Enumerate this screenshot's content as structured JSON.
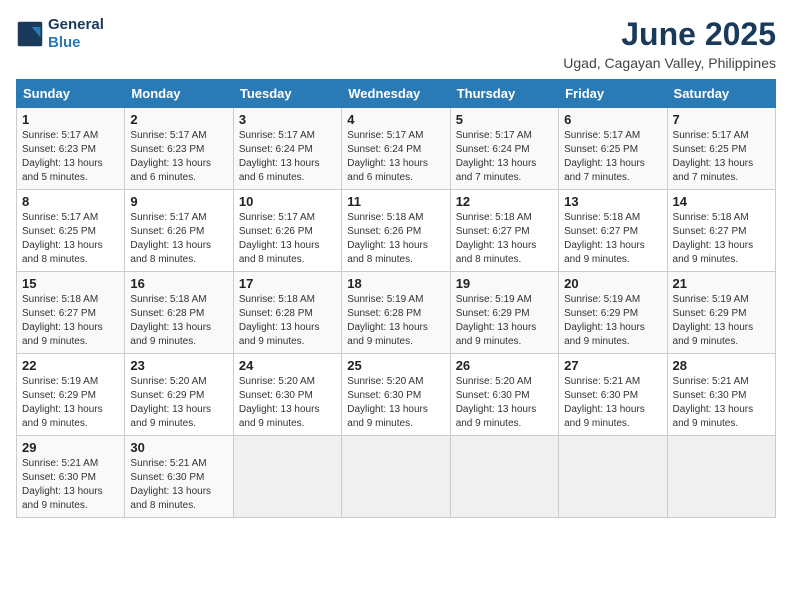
{
  "header": {
    "logo_line1": "General",
    "logo_line2": "Blue",
    "title": "June 2025",
    "subtitle": "Ugad, Cagayan Valley, Philippines"
  },
  "columns": [
    "Sunday",
    "Monday",
    "Tuesday",
    "Wednesday",
    "Thursday",
    "Friday",
    "Saturday"
  ],
  "weeks": [
    [
      {
        "day": "1",
        "sunrise": "5:17 AM",
        "sunset": "6:23 PM",
        "daylight": "13 hours and 5 minutes."
      },
      {
        "day": "2",
        "sunrise": "5:17 AM",
        "sunset": "6:23 PM",
        "daylight": "13 hours and 6 minutes."
      },
      {
        "day": "3",
        "sunrise": "5:17 AM",
        "sunset": "6:24 PM",
        "daylight": "13 hours and 6 minutes."
      },
      {
        "day": "4",
        "sunrise": "5:17 AM",
        "sunset": "6:24 PM",
        "daylight": "13 hours and 6 minutes."
      },
      {
        "day": "5",
        "sunrise": "5:17 AM",
        "sunset": "6:24 PM",
        "daylight": "13 hours and 7 minutes."
      },
      {
        "day": "6",
        "sunrise": "5:17 AM",
        "sunset": "6:25 PM",
        "daylight": "13 hours and 7 minutes."
      },
      {
        "day": "7",
        "sunrise": "5:17 AM",
        "sunset": "6:25 PM",
        "daylight": "13 hours and 7 minutes."
      }
    ],
    [
      {
        "day": "8",
        "sunrise": "5:17 AM",
        "sunset": "6:25 PM",
        "daylight": "13 hours and 8 minutes."
      },
      {
        "day": "9",
        "sunrise": "5:17 AM",
        "sunset": "6:26 PM",
        "daylight": "13 hours and 8 minutes."
      },
      {
        "day": "10",
        "sunrise": "5:17 AM",
        "sunset": "6:26 PM",
        "daylight": "13 hours and 8 minutes."
      },
      {
        "day": "11",
        "sunrise": "5:18 AM",
        "sunset": "6:26 PM",
        "daylight": "13 hours and 8 minutes."
      },
      {
        "day": "12",
        "sunrise": "5:18 AM",
        "sunset": "6:27 PM",
        "daylight": "13 hours and 8 minutes."
      },
      {
        "day": "13",
        "sunrise": "5:18 AM",
        "sunset": "6:27 PM",
        "daylight": "13 hours and 9 minutes."
      },
      {
        "day": "14",
        "sunrise": "5:18 AM",
        "sunset": "6:27 PM",
        "daylight": "13 hours and 9 minutes."
      }
    ],
    [
      {
        "day": "15",
        "sunrise": "5:18 AM",
        "sunset": "6:27 PM",
        "daylight": "13 hours and 9 minutes."
      },
      {
        "day": "16",
        "sunrise": "5:18 AM",
        "sunset": "6:28 PM",
        "daylight": "13 hours and 9 minutes."
      },
      {
        "day": "17",
        "sunrise": "5:18 AM",
        "sunset": "6:28 PM",
        "daylight": "13 hours and 9 minutes."
      },
      {
        "day": "18",
        "sunrise": "5:19 AM",
        "sunset": "6:28 PM",
        "daylight": "13 hours and 9 minutes."
      },
      {
        "day": "19",
        "sunrise": "5:19 AM",
        "sunset": "6:29 PM",
        "daylight": "13 hours and 9 minutes."
      },
      {
        "day": "20",
        "sunrise": "5:19 AM",
        "sunset": "6:29 PM",
        "daylight": "13 hours and 9 minutes."
      },
      {
        "day": "21",
        "sunrise": "5:19 AM",
        "sunset": "6:29 PM",
        "daylight": "13 hours and 9 minutes."
      }
    ],
    [
      {
        "day": "22",
        "sunrise": "5:19 AM",
        "sunset": "6:29 PM",
        "daylight": "13 hours and 9 minutes."
      },
      {
        "day": "23",
        "sunrise": "5:20 AM",
        "sunset": "6:29 PM",
        "daylight": "13 hours and 9 minutes."
      },
      {
        "day": "24",
        "sunrise": "5:20 AM",
        "sunset": "6:30 PM",
        "daylight": "13 hours and 9 minutes."
      },
      {
        "day": "25",
        "sunrise": "5:20 AM",
        "sunset": "6:30 PM",
        "daylight": "13 hours and 9 minutes."
      },
      {
        "day": "26",
        "sunrise": "5:20 AM",
        "sunset": "6:30 PM",
        "daylight": "13 hours and 9 minutes."
      },
      {
        "day": "27",
        "sunrise": "5:21 AM",
        "sunset": "6:30 PM",
        "daylight": "13 hours and 9 minutes."
      },
      {
        "day": "28",
        "sunrise": "5:21 AM",
        "sunset": "6:30 PM",
        "daylight": "13 hours and 9 minutes."
      }
    ],
    [
      {
        "day": "29",
        "sunrise": "5:21 AM",
        "sunset": "6:30 PM",
        "daylight": "13 hours and 9 minutes."
      },
      {
        "day": "30",
        "sunrise": "5:21 AM",
        "sunset": "6:30 PM",
        "daylight": "13 hours and 8 minutes."
      },
      null,
      null,
      null,
      null,
      null
    ]
  ]
}
